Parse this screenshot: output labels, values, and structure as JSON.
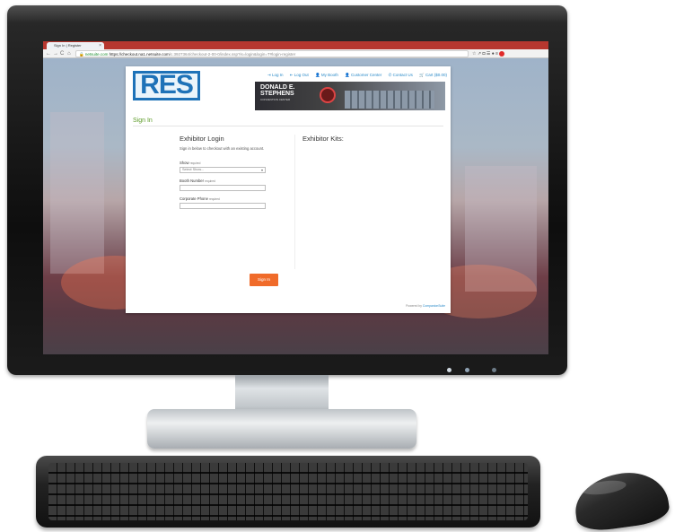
{
  "browser": {
    "tab_title": "Sign In | Register",
    "tab_close": "×",
    "nav_back": "←",
    "nav_forward": "→",
    "nav_reload": "C",
    "nav_home": "⌂",
    "url_secure": "netsuite.com",
    "url_host": "https://checkout.na1.netsuite.com",
    "url_path": "/c.3927364/checkout-2-00-0/index.ssp?is=login&login=T#login-register",
    "ext_icons": "☆ ↗ ◘ ☰ ● ≡"
  },
  "header": {
    "logo_text": "RES",
    "nav": {
      "log_in": "⇥ Log In",
      "log_out": "⇤ Log Out",
      "my_booth": "👤 My Booth",
      "customer_center": "👤 Customer Center",
      "contact_us": "✆ Contact Us",
      "cart": "🛒 Cart ($0.00)"
    },
    "banner": {
      "title": "DONALD E. STEPHENS",
      "subtitle": "CONVENTION CENTER"
    }
  },
  "page": {
    "title": "Sign In"
  },
  "login": {
    "heading": "Exhibitor Login",
    "description": "Sign in below to checkout with an existing account.",
    "show_label": "Show",
    "show_required": "required",
    "show_value": "Select Show...",
    "booth_label": "Booth Number",
    "booth_required": "required",
    "booth_value": "",
    "phone_label": "Corporate Phone",
    "phone_required": "required",
    "phone_value": "",
    "button": "Sign In"
  },
  "kits": {
    "heading": "Exhibitor Kits:"
  },
  "footer": {
    "powered_prefix": "Powered by",
    "powered_brand": "CompanionSuite"
  },
  "colors": {
    "accent_green": "#5e9c2a",
    "link_blue": "#2a8ac8",
    "button_orange": "#f06b2a",
    "logo_blue": "#1e72b8",
    "tab_strip_red": "#b7372f"
  }
}
